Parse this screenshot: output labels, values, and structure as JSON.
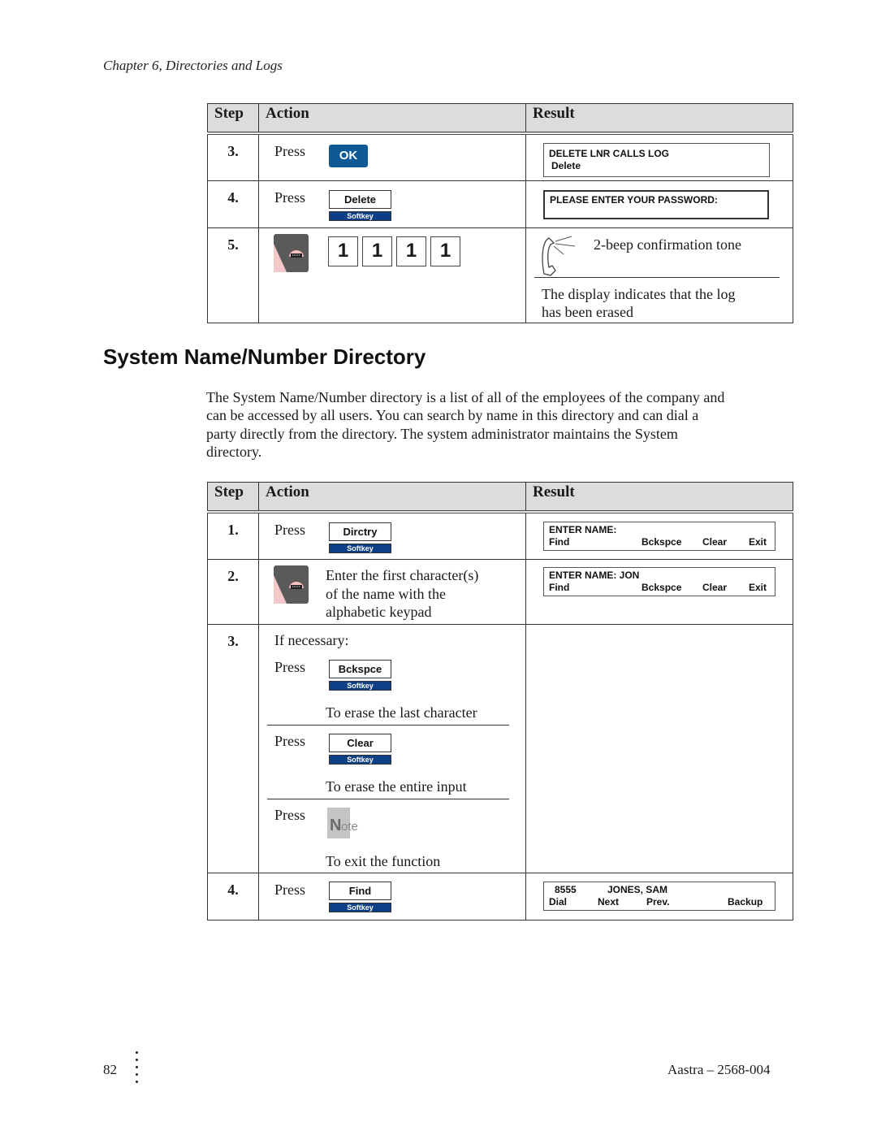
{
  "page": {
    "chapter_header": "Chapter 6, Directories and Logs",
    "page_number": "82",
    "document_id": "Aastra – 2568-004"
  },
  "colors": {
    "key_blue": "#0d5a96",
    "softkey_blue": "#0d3f86",
    "header_gray": "#dcdcdc"
  },
  "table1": {
    "headers": {
      "step": "Step",
      "action": "Action",
      "result": "Result"
    },
    "rows": [
      {
        "step": "3.",
        "action": {
          "press": "Press",
          "key": "OK",
          "key_type": "ok-key"
        },
        "result": {
          "display_lines": [
            "DELETE LNR CALLS LOG",
            "Delete"
          ]
        }
      },
      {
        "step": "4.",
        "action": {
          "press": "Press",
          "key": "Delete",
          "key_sub": "Softkey"
        },
        "result": {
          "display_lines": [
            "PLEASE ENTER YOUR PASSWORD:"
          ]
        }
      },
      {
        "step": "5.",
        "action": {
          "icon": "keypad-icon",
          "digits": [
            "1",
            "1",
            "1",
            "1"
          ]
        },
        "result": {
          "icon": "handset-icon",
          "tone": "2-beep confirmation tone",
          "text": "The display indicates that the log has been erased",
          "text_line1": "The display indicates that the log",
          "text_line2": "has been erased"
        }
      }
    ]
  },
  "section": {
    "title": "System Name/Number Directory",
    "intro_lines": [
      "The System Name/Number directory is a list of all of the employees of the company and",
      "can be accessed by all users.  You can search by name in this directory and can dial a",
      "party directly from the directory.  The system administrator maintains the System",
      "directory."
    ]
  },
  "table2": {
    "headers": {
      "step": "Step",
      "action": "Action",
      "result": "Result"
    },
    "rows": [
      {
        "step": "1.",
        "action": {
          "press": "Press",
          "key": "Dirctry",
          "key_sub": "Softkey"
        },
        "result": {
          "line1": "ENTER NAME:",
          "softkeys": [
            "Find",
            "Bckspce",
            "Clear",
            "Exit"
          ]
        }
      },
      {
        "step": "2.",
        "action": {
          "icon": "keypad-icon",
          "lines": [
            "Enter the first character(s)",
            "of the name with the",
            "alphabetic keypad"
          ]
        },
        "result": {
          "line1": "ENTER NAME: JON",
          "softkeys": [
            "Find",
            "Bckspce",
            "Clear",
            "Exit"
          ]
        }
      },
      {
        "step": "3.",
        "action": {
          "intro": "If necessary:",
          "substeps": [
            {
              "press": "Press",
              "key": "Bckspce",
              "key_sub": "Softkey",
              "desc": "To erase the last character"
            },
            {
              "press": "Press",
              "key": "Clear",
              "key_sub": "Softkey",
              "desc": "To erase the entire input"
            },
            {
              "press": "Press",
              "key_icon": "note-key-icon",
              "key_label": "Note",
              "desc": "To exit the function"
            }
          ]
        },
        "result": {}
      },
      {
        "step": "4.",
        "action": {
          "press": "Press",
          "key": "Find",
          "key_sub": "Softkey"
        },
        "result": {
          "line1_number": "8555",
          "line1_name": "JONES, SAM",
          "softkeys": [
            "Dial",
            "Next",
            "Prev.",
            "Backup"
          ]
        }
      }
    ]
  }
}
